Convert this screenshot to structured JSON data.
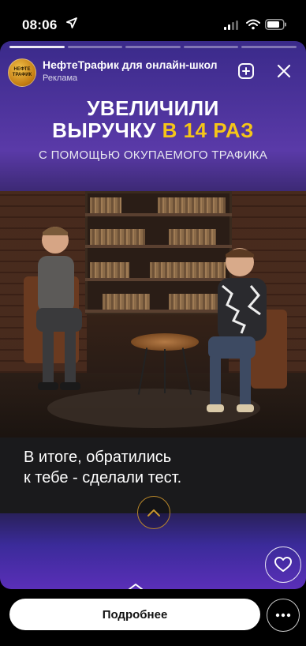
{
  "status_bar": {
    "time": "08:06",
    "icons": [
      "location-arrow-icon",
      "signal-icon",
      "wifi-icon",
      "battery-icon"
    ]
  },
  "story": {
    "progress": [
      1,
      0,
      0,
      0,
      0
    ],
    "account": {
      "name": "НефтеТрафик для онлайн-школ",
      "sponsored_label": "Реклама",
      "avatar_text": "НЕФТЕ ТРАФИК"
    },
    "headline": {
      "line1": "УВЕЛИЧИЛИ",
      "line2_prefix": "ВЫРУЧКУ ",
      "line2_accent": "В 14 РАЗ",
      "subtitle": "С ПОМОЩЬЮ ОКУПАЕМОГО ТРАФИКА"
    },
    "caption": {
      "line1": "В итоге, обратились",
      "line2": "к тебе - сделали тест."
    },
    "colors": {
      "accent": "#f5c518",
      "gradient_top": "#5a3aa8",
      "gradient_bottom": "#5a2fb8"
    }
  },
  "cta": {
    "label": "Подробнее"
  }
}
